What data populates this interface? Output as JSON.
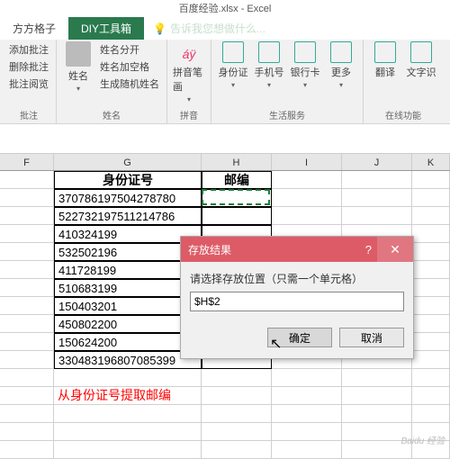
{
  "app": {
    "title": "百度经验.xlsx - Excel"
  },
  "tabs": {
    "square": "方方格子",
    "diy": "DIY工具箱",
    "tellme": "告诉我您想做什么..."
  },
  "ribbon": {
    "comments": {
      "add": "添加批注",
      "del": "删除批注",
      "read": "批注阅览",
      "group": "批注"
    },
    "names": {
      "btn": "姓名",
      "split": "姓名分开",
      "space": "姓名加空格",
      "rand": "生成随机姓名",
      "group": "姓名"
    },
    "pinyin": {
      "btn": "拼音笔画",
      "group": "拼音"
    },
    "life": {
      "id": "身份证",
      "phone": "手机号",
      "bank": "银行卡",
      "more": "更多",
      "group": "生活服务"
    },
    "online": {
      "trans": "翻译",
      "rec": "文字识",
      "group": "在线功能"
    }
  },
  "cols": {
    "F": "F",
    "G": "G",
    "H": "H",
    "I": "I",
    "J": "J",
    "K": "K"
  },
  "headers": {
    "id": "身份证号",
    "zip": "邮编"
  },
  "ids": [
    "370786197504278780",
    "522732197511214786",
    "410324199",
    "532502196",
    "411728199",
    "510683199",
    "150403201",
    "450802200",
    "150624200",
    "330483196807085399"
  ],
  "note": "从身份证号提取邮编",
  "dialog": {
    "title": "存放结果",
    "prompt": "请选择存放位置（只需一个单元格）",
    "value": "$H$2",
    "ok": "确定",
    "cancel": "取消"
  },
  "watermark": "Baidu 经验"
}
